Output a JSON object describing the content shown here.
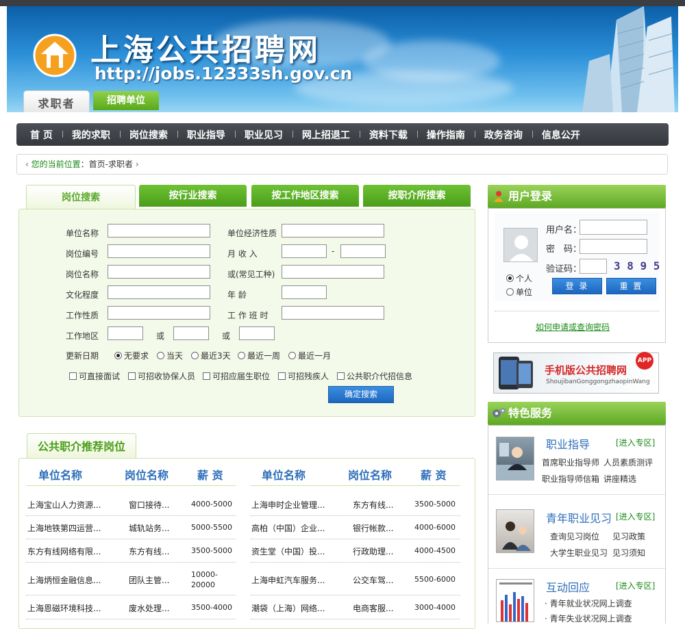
{
  "header": {
    "title": "上海公共招聘网",
    "url": "http://jobs.12333sh.gov.cn",
    "tab_seeker": "求职者",
    "tab_employer": "招聘单位"
  },
  "nav": [
    "首 页",
    "我的求职",
    "岗位搜索",
    "职业指导",
    "职业见习",
    "网上招退工",
    "资料下载",
    "操作指南",
    "政务咨询",
    "信息公开"
  ],
  "breadcrumb": {
    "label": "您的当前位置",
    "sep": "：",
    "path": "首页-求职者"
  },
  "search": {
    "tabs": [
      "岗位搜索",
      "按行业搜索",
      "按工作地区搜索",
      "按职介所搜索"
    ],
    "labels": {
      "unit_name": "单位名称",
      "unit_type": "单位经济性质",
      "job_no": "岗位编号",
      "income": "月 收 入",
      "job_name": "岗位名称",
      "common_job": "或(常见工种)",
      "education": "文化程度",
      "age": "年 龄",
      "work_type": "工作性质",
      "shift": "工 作 班 时",
      "area": "工作地区",
      "or": "或",
      "dash": "-",
      "update": "更新日期"
    },
    "update_options": [
      "无要求",
      "当天",
      "最近3天",
      "最近一周",
      "最近一月"
    ],
    "checkboxes": [
      "可直接面试",
      "可招收协保人员",
      "可招应届生职位",
      "可招残疾人",
      "公共职介代招信息"
    ],
    "submit": "确定搜索"
  },
  "recommend": {
    "title": "公共职介推荐岗位",
    "headers": [
      "单位名称",
      "岗位名称",
      "薪 资",
      "单位名称",
      "岗位名称",
      "薪 资"
    ],
    "left": [
      {
        "unit": "上海宝山人力资源...",
        "job": "窗口接待...",
        "pay": "4000-5000"
      },
      {
        "unit": "上海地铁第四运营...",
        "job": "城轨站务...",
        "pay": "5000-5500"
      },
      {
        "unit": "东方有线网络有限...",
        "job": "东方有线...",
        "pay": "3500-5000"
      },
      {
        "unit": "上海炳恒金融信息...",
        "job": "团队主管...",
        "pay": "10000-20000",
        "pay1": "10000-",
        "pay2": "20000"
      },
      {
        "unit": "上海恩磁环境科技...",
        "job": "废水处理...",
        "pay": "3500-4000"
      }
    ],
    "right": [
      {
        "unit": "上海申时企业管理...",
        "job": "东方有线...",
        "pay": "3500-5000"
      },
      {
        "unit": "高柏（中国）企业...",
        "job": "银行帐款...",
        "pay": "4000-6000"
      },
      {
        "unit": "资生堂（中国）投...",
        "job": "行政助理...",
        "pay": "4000-4500"
      },
      {
        "unit": "上海申虹汽车服务...",
        "job": "公交车驾...",
        "pay": "5500-6000"
      },
      {
        "unit": "潮袋（上海）网络...",
        "job": "电商客服...",
        "pay": "3000-4000"
      }
    ]
  },
  "login": {
    "title": "用户登录",
    "username": "用户名：",
    "password": "密　码：",
    "captcha_label": "验证码：",
    "captcha": "3 8 9 5",
    "role_personal": "个人",
    "role_unit": "单位",
    "login_btn": "登 录",
    "reset_btn": "重 置",
    "help": "如何申请或查询密码"
  },
  "app": {
    "title": "手机版公共招聘网",
    "pinyin": "ShoujibanGonggongzhaopinWang",
    "badge": "APP"
  },
  "services": {
    "title": "特色服务",
    "enter": "[进入专区]",
    "items": [
      {
        "title": "职业指导",
        "links": [
          "首席职业指导师",
          "人员素质测评",
          "职业指导师信箱",
          "讲座精选"
        ]
      },
      {
        "title": "青年职业见习",
        "links": [
          "查询见习岗位",
          "见习政策",
          "大学生职业见习",
          "见习须知"
        ]
      },
      {
        "title": "互动回应",
        "links": [
          "· 青年就业状况网上调查",
          "· 青年失业状况网上调查"
        ]
      }
    ]
  }
}
